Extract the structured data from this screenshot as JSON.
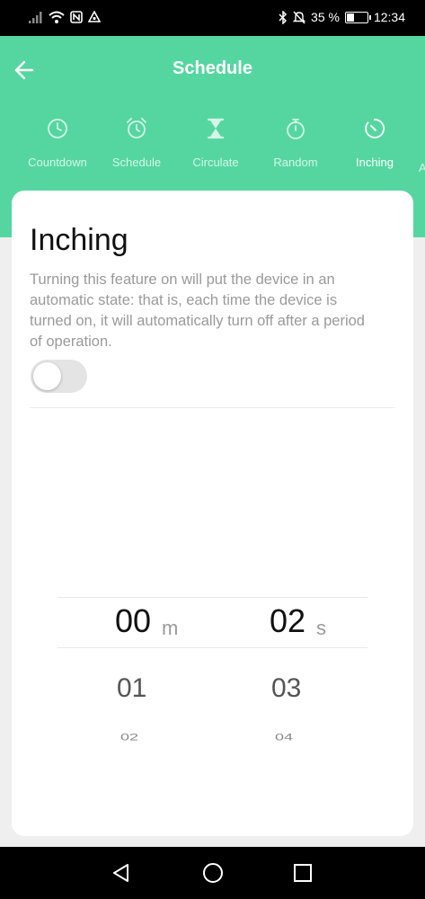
{
  "status_bar": {
    "battery_percent": "35 %",
    "time": "12:34",
    "icons": [
      "signal-icon",
      "wifi-icon",
      "nfc-icon",
      "data-saver-icon",
      "bluetooth-icon",
      "mute-icon",
      "battery-icon"
    ]
  },
  "header": {
    "title": "Schedule",
    "back_icon": "arrow-left-icon",
    "background_color": "#55d6a0"
  },
  "tabs": [
    {
      "label": "Countdown",
      "icon": "clock-icon",
      "active": false
    },
    {
      "label": "Schedule",
      "icon": "alarm-clock-icon",
      "active": false
    },
    {
      "label": "Circulate",
      "icon": "hourglass-icon",
      "active": false
    },
    {
      "label": "Random",
      "icon": "stopwatch-icon",
      "active": false
    },
    {
      "label": "Inching",
      "icon": "timer-icon",
      "active": true
    },
    {
      "label": "A",
      "icon": "",
      "active": false
    }
  ],
  "card": {
    "title": "Inching",
    "description": "Turning this feature on will put the device in an automatic state: that is, each time the device is turned on, it will automatically turn off after a period of operation.",
    "toggle_on": false
  },
  "picker": {
    "minutes": {
      "selected": "00",
      "unit": "m",
      "next": "01",
      "next2": "02"
    },
    "seconds": {
      "selected": "02",
      "unit": "s",
      "next": "03",
      "next2": "04"
    }
  },
  "nav_bar": {
    "icons": [
      "back-triangle-icon",
      "home-circle-icon",
      "recents-square-icon"
    ]
  }
}
